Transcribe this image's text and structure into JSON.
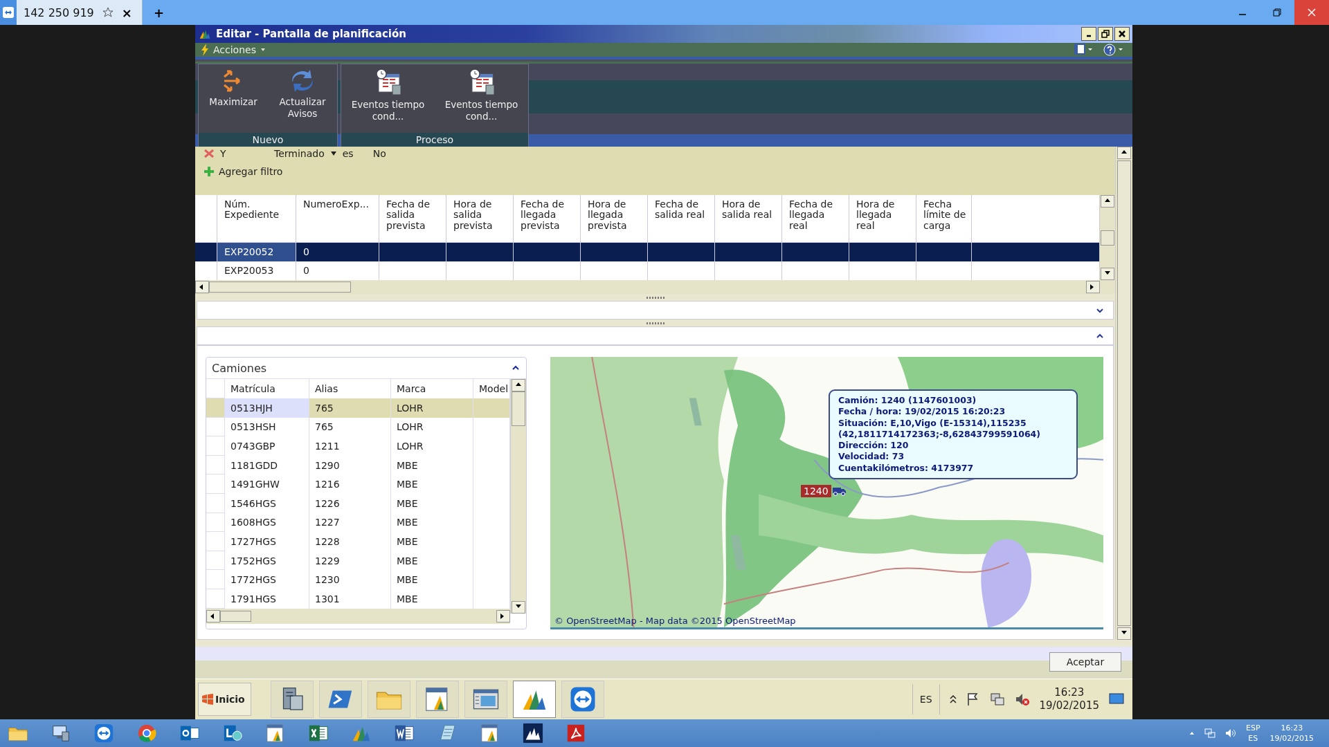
{
  "viewer_tab": {
    "title": "142 250 919",
    "close": "×",
    "new_tab": "+"
  },
  "window": {
    "title": "Editar - Pantalla de planificación",
    "menu": "Acciones"
  },
  "ribbon_groups": [
    {
      "label": "Nuevo",
      "buttons": [
        {
          "label": "Maximizar",
          "kind": "arrows"
        },
        {
          "label": "Actualizar Avisos",
          "kind": "refresh"
        }
      ]
    },
    {
      "label": "Proceso",
      "buttons": [
        {
          "label": "Eventos tiempo cond...",
          "kind": "calendar"
        },
        {
          "label": "Eventos tiempo cond...",
          "kind": "calendar"
        }
      ]
    }
  ],
  "filter": {
    "conjunction": "Y",
    "field": "Terminado",
    "operator": "es",
    "value": "No",
    "add_filter": "Agregar filtro"
  },
  "grid": {
    "columns": [
      "Núm. Expediente",
      "NumeroExp...",
      "Fecha de salida prevista",
      "Hora de salida prevista",
      "Fecha de llegada prevista",
      "Hora de llegada prevista",
      "Fecha de salida real",
      "Hora de salida real",
      "Fecha de llegada real",
      "Hora de llegada real",
      "Fecha límite de carga"
    ],
    "rows": [
      {
        "selected": true,
        "cells": [
          "EXP20052",
          "0"
        ]
      },
      {
        "selected": false,
        "cells": [
          "EXP20053",
          "0"
        ]
      }
    ]
  },
  "trucks": {
    "title": "Camiones",
    "columns": [
      "Matrícula",
      "Alias",
      "Marca",
      "Model"
    ],
    "rows": [
      {
        "selected": true,
        "cells": [
          "0513HJH",
          "765",
          "LOHR"
        ]
      },
      {
        "selected": false,
        "cells": [
          "0513HSH",
          "765",
          "LOHR"
        ]
      },
      {
        "selected": false,
        "cells": [
          "0743GBP",
          "1211",
          "LOHR"
        ]
      },
      {
        "selected": false,
        "cells": [
          "1181GDD",
          "1290",
          "MBE"
        ]
      },
      {
        "selected": false,
        "cells": [
          "1491GHW",
          "1216",
          "MBE"
        ]
      },
      {
        "selected": false,
        "cells": [
          "1546HGS",
          "1226",
          "MBE"
        ]
      },
      {
        "selected": false,
        "cells": [
          "1608HGS",
          "1227",
          "MBE"
        ]
      },
      {
        "selected": false,
        "cells": [
          "1727HGS",
          "1228",
          "MBE"
        ]
      },
      {
        "selected": false,
        "cells": [
          "1752HGS",
          "1229",
          "MBE"
        ]
      },
      {
        "selected": false,
        "cells": [
          "1772HGS",
          "1230",
          "MBE"
        ]
      },
      {
        "selected": false,
        "cells": [
          "1791HGS",
          "1301",
          "MBE"
        ]
      }
    ]
  },
  "map": {
    "kind": "picture",
    "marker": "1240",
    "attribution": "© OpenStreetMap - Map data ©2015 OpenStreetMap",
    "tooltip": [
      "Camión: 1240 (1147601003)",
      "Fecha / hora: 19/02/2015 16:20:23",
      "Situación: E,10,Vigo (E-15314),115235",
      "(42,1811714172363;-8,62843799591064)",
      "Dirección: 120",
      "Velocidad: 73",
      "Cuentakilómetros: 4173977"
    ]
  },
  "footer": {
    "button": "Aceptar"
  },
  "remote_taskbar": {
    "start": "Inicio",
    "apps": [
      {
        "kind": "server",
        "selected": false
      },
      {
        "kind": "shell",
        "selected": false
      },
      {
        "kind": "folder",
        "selected": false
      },
      {
        "kind": "report",
        "selected": false
      },
      {
        "kind": "window",
        "selected": false
      },
      {
        "kind": "dynamics",
        "selected": true
      },
      {
        "kind": "teamviewer",
        "selected": false
      }
    ],
    "language": "ES",
    "time": "16:23",
    "date": "19/02/2015"
  },
  "local_taskbar": {
    "apps": [
      {
        "kind": "folder"
      },
      {
        "kind": "computer"
      },
      {
        "kind": "teamviewer"
      },
      {
        "kind": "chrome"
      },
      {
        "kind": "outlook"
      },
      {
        "kind": "lync"
      },
      {
        "kind": "report"
      },
      {
        "kind": "excel"
      },
      {
        "kind": "dynamics"
      },
      {
        "kind": "word"
      },
      {
        "kind": "notes"
      },
      {
        "kind": "report"
      },
      {
        "kind": "dynamics-dark"
      },
      {
        "kind": "acrobat"
      }
    ],
    "language": "ESP",
    "input": "ES",
    "time": "16:23",
    "date": "19/02/2015"
  }
}
